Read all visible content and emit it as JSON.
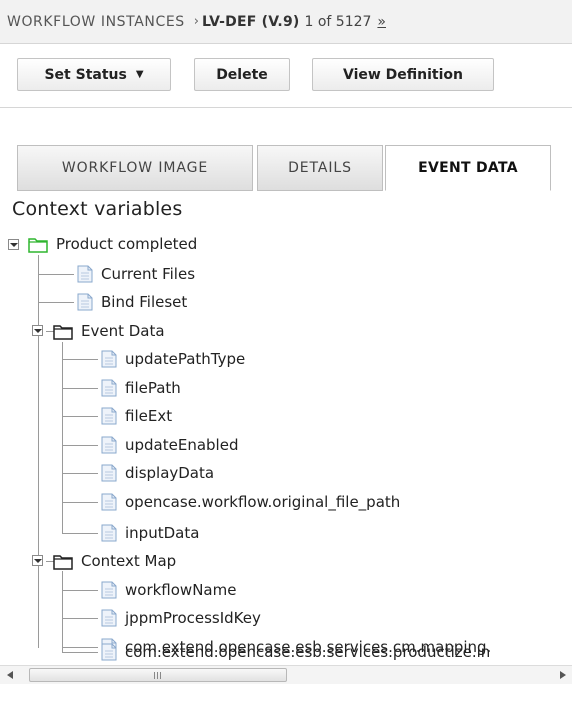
{
  "breadcrumb": {
    "root": "WORKFLOW INSTANCES",
    "separator": "›",
    "current": "LV-DEF (V.9)",
    "position": "1 of 5127",
    "next": "»"
  },
  "toolbar": {
    "set_status_label": "Set Status",
    "set_status_caret": "▼",
    "delete_label": "Delete",
    "view_definition_label": "View Definition"
  },
  "tabs": {
    "workflow_image": "WORKFLOW IMAGE",
    "details": "DETAILS",
    "event_data": "EVENT DATA",
    "active": "event_data"
  },
  "section_title": "Context variables",
  "tree": {
    "root": "Product completed",
    "current_files": "Current Files",
    "bind_fileset": "Bind Fileset",
    "event_data": {
      "label": "Event Data",
      "children": [
        "updatePathType",
        "filePath",
        "fileExt",
        "updateEnabled",
        "displayData",
        "opencase.workflow.original_file_path",
        "inputData"
      ]
    },
    "context_map": {
      "label": "Context Map",
      "children": [
        "workflowName",
        "jppmProcessIdKey",
        "com.extend.opencase.esb.services.cm.mapping.",
        "com.extend.opencase.esb.services.productize.in"
      ]
    }
  },
  "scrollbar": {
    "grip": "III"
  },
  "colors": {
    "root_folder": "#2fb52f",
    "folder": "#222222",
    "doc_icon": "#8aa8cc"
  }
}
